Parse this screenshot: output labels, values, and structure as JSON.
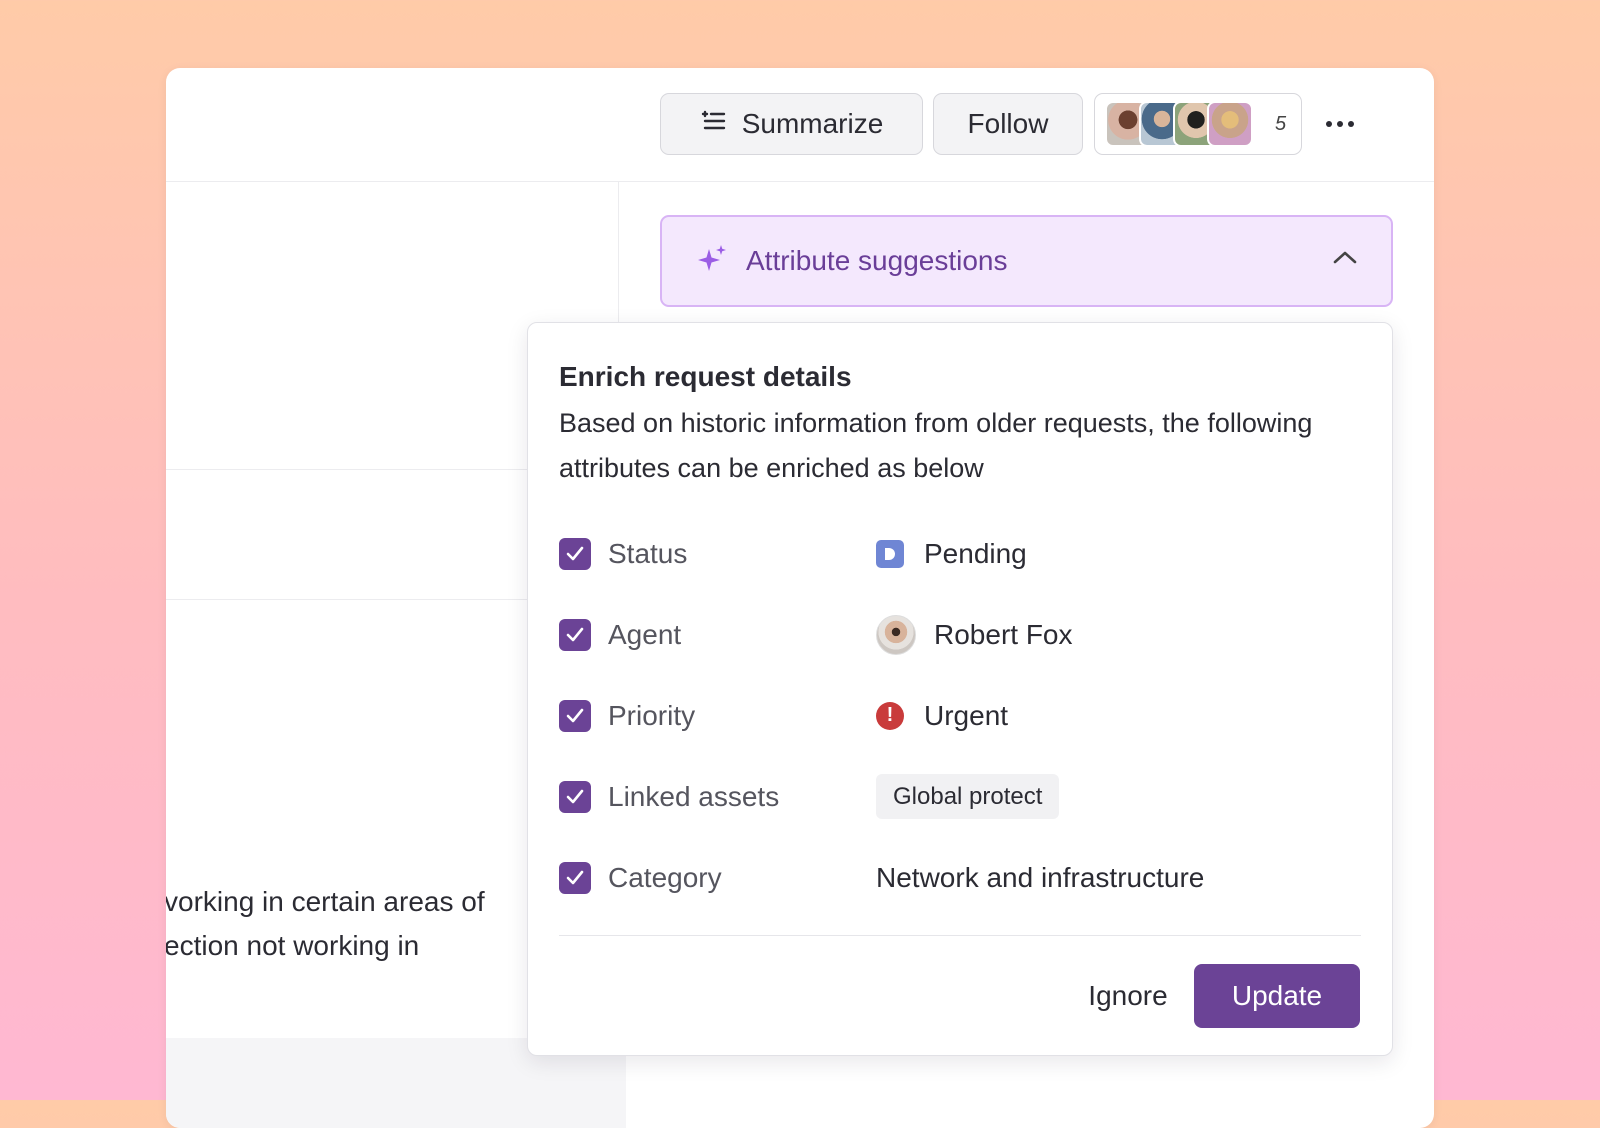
{
  "header": {
    "summarize_label": "Summarize",
    "follow_label": "Follow",
    "followers_count": "5",
    "more_icon": "more-horizontal-icon"
  },
  "background": {
    "text": "vorking in certain areas of\nection not working in"
  },
  "suggestions": {
    "label": "Attribute suggestions",
    "icon": "sparkle-icon"
  },
  "popover": {
    "title": "Enrich request details",
    "description": "Based on historic information from older requests, the following attributes can be enriched as below",
    "attributes": [
      {
        "label": "Status",
        "value": "Pending",
        "checked": true
      },
      {
        "label": "Agent",
        "value": "Robert Fox",
        "checked": true
      },
      {
        "label": "Priority",
        "value": "Urgent",
        "checked": true
      },
      {
        "label": "Linked assets",
        "value": "Global protect",
        "checked": true
      },
      {
        "label": "Category",
        "value": "Network and infrastructure",
        "checked": true
      }
    ],
    "ignore_label": "Ignore",
    "update_label": "Update"
  },
  "colors": {
    "accent": "#6b4396",
    "suggestion_bg": "#f4e8fd",
    "status_pending": "#6f86d4",
    "priority_urgent": "#c93b3b"
  }
}
